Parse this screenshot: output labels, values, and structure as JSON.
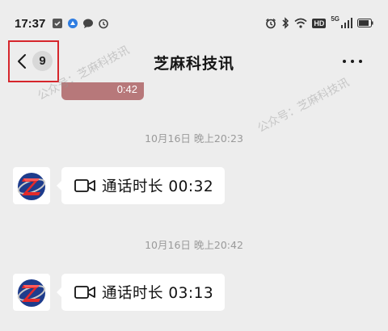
{
  "status_bar": {
    "time": "17:37",
    "left_icons": [
      "notification-icon",
      "browser-icon",
      "message-icon",
      "alarm-icon"
    ],
    "right_icons": [
      "alarm-icon",
      "bluetooth-icon",
      "wifi-icon",
      "hd-icon",
      "signal-5g-icon",
      "signal-icon",
      "battery-icon"
    ],
    "hd_label": "HD",
    "network_label": "5G"
  },
  "header": {
    "back_count": "9",
    "title": "芝麻科技讯",
    "more_icon": "more-icon"
  },
  "messages": [
    {
      "type": "video",
      "duration": "0:42",
      "color": "#b7787a"
    },
    {
      "type": "timestamp",
      "text": "10月16日 晚上20:23"
    },
    {
      "type": "call",
      "label": "通话时长 00:32",
      "icon": "video-call-icon"
    },
    {
      "type": "timestamp",
      "text": "10月16日 晚上20:42"
    },
    {
      "type": "call",
      "label": "通话时长 03:13",
      "icon": "video-call-icon"
    }
  ],
  "watermark": "公众号：芝麻科技讯",
  "colors": {
    "background": "#ededed",
    "bubble": "#ffffff",
    "highlight_border": "#d6262c",
    "timestamp": "#9a9a9a"
  }
}
